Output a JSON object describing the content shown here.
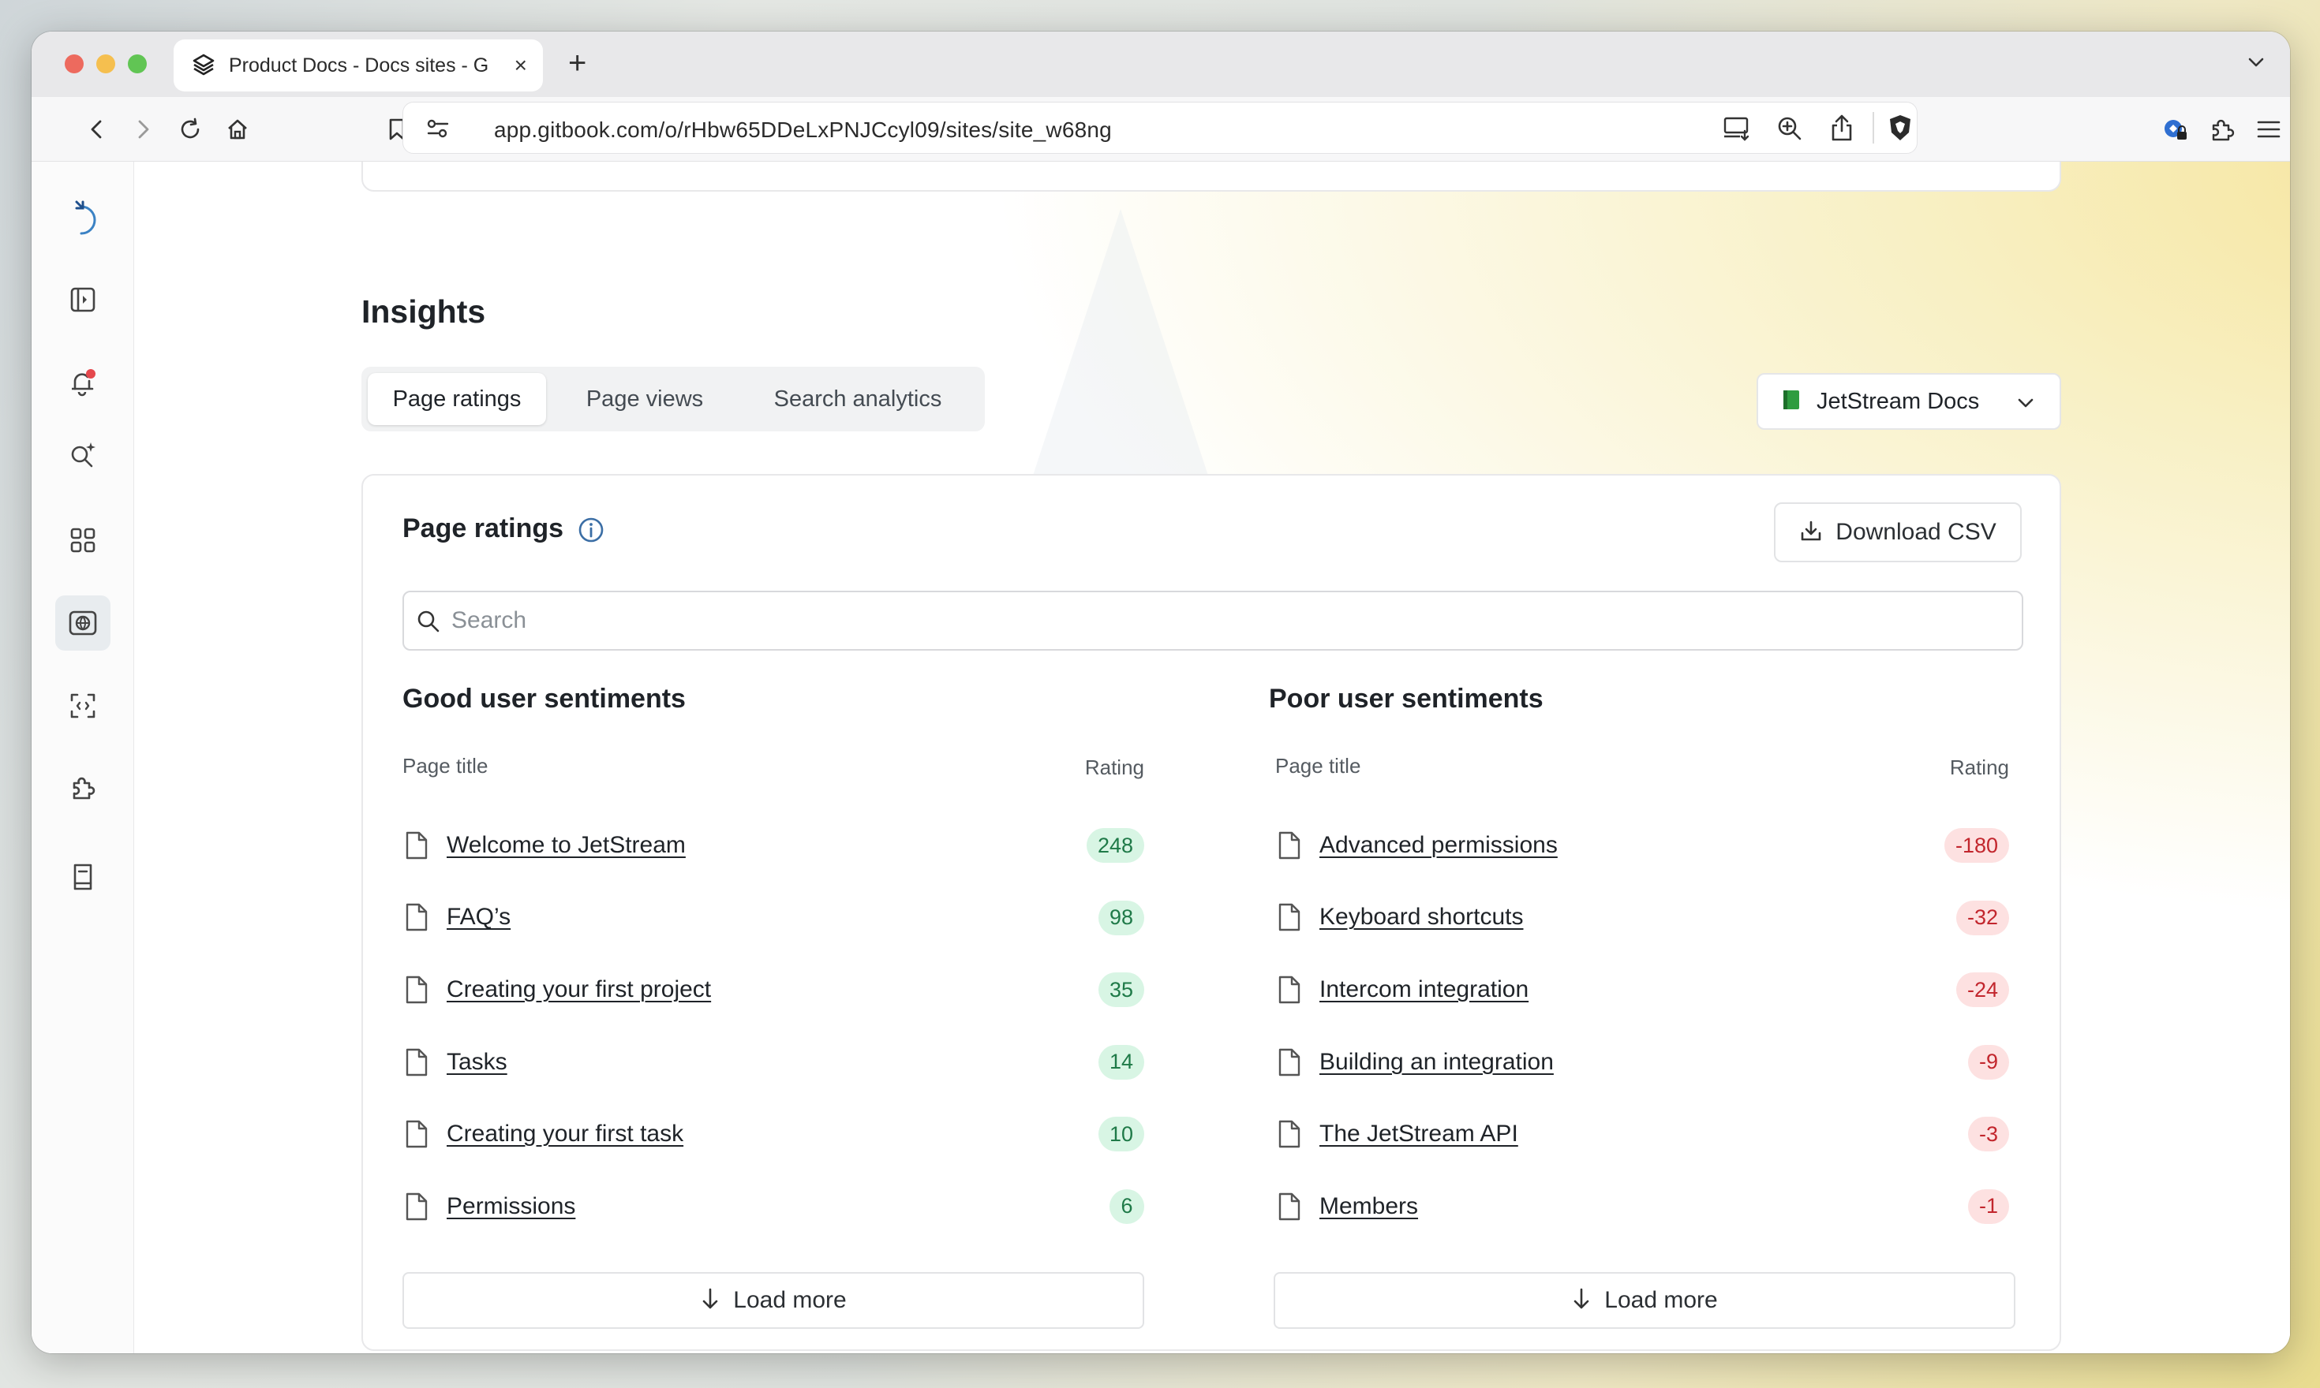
{
  "browser": {
    "tab_title": "Product Docs - Docs sites - GitBook",
    "url": "app.gitbook.com/o/rHbw65DDeLxPNJCcyl09/sites/site_w68ng"
  },
  "sidebar": {
    "items": [
      {
        "name": "gitbook-logo-icon"
      },
      {
        "name": "toggle-sidebar-icon"
      },
      {
        "name": "notifications-icon",
        "badge_color": "#e5484d"
      },
      {
        "name": "search-ai-icon"
      },
      {
        "name": "apps-grid-icon"
      },
      {
        "name": "docs-sites-icon",
        "active": true
      },
      {
        "name": "scan-icon"
      },
      {
        "name": "integrations-icon"
      },
      {
        "name": "docs-book-icon"
      }
    ]
  },
  "insights": {
    "title": "Insights",
    "tabs": [
      {
        "label": "Page ratings",
        "active": true
      },
      {
        "label": "Page views",
        "active": false
      },
      {
        "label": "Search analytics",
        "active": false
      }
    ],
    "site_selector": {
      "label": "JetStream Docs",
      "color": "#2e9c3f"
    }
  },
  "panel": {
    "title": "Page ratings",
    "download_label": "Download CSV",
    "search_placeholder": "Search",
    "good": {
      "title": "Good user sentiments",
      "col_title": "Page title",
      "col_rating": "Rating",
      "rows": [
        {
          "title": "Welcome to JetStream",
          "rating": "248"
        },
        {
          "title": "FAQ’s",
          "rating": "98"
        },
        {
          "title": "Creating your first project",
          "rating": "35"
        },
        {
          "title": "Tasks",
          "rating": "14"
        },
        {
          "title": "Creating your first task",
          "rating": "10"
        },
        {
          "title": "Permissions",
          "rating": "6"
        }
      ],
      "load_more": "Load more"
    },
    "poor": {
      "title": "Poor user sentiments",
      "col_title": "Page title",
      "col_rating": "Rating",
      "rows": [
        {
          "title": "Advanced permissions",
          "rating": "-180"
        },
        {
          "title": "Keyboard shortcuts",
          "rating": "-32"
        },
        {
          "title": "Intercom integration",
          "rating": "-24"
        },
        {
          "title": "Building an integration",
          "rating": "-9"
        },
        {
          "title": "The JetStream API",
          "rating": "-3"
        },
        {
          "title": "Members",
          "rating": "-1"
        }
      ],
      "load_more": "Load more"
    }
  },
  "colors": {
    "good_badge_bg": "#d8f5e4",
    "good_badge_text": "#1f7a48",
    "bad_badge_bg": "#fde1e1",
    "bad_badge_text": "#c2262d",
    "accent": "#3b82c4"
  }
}
